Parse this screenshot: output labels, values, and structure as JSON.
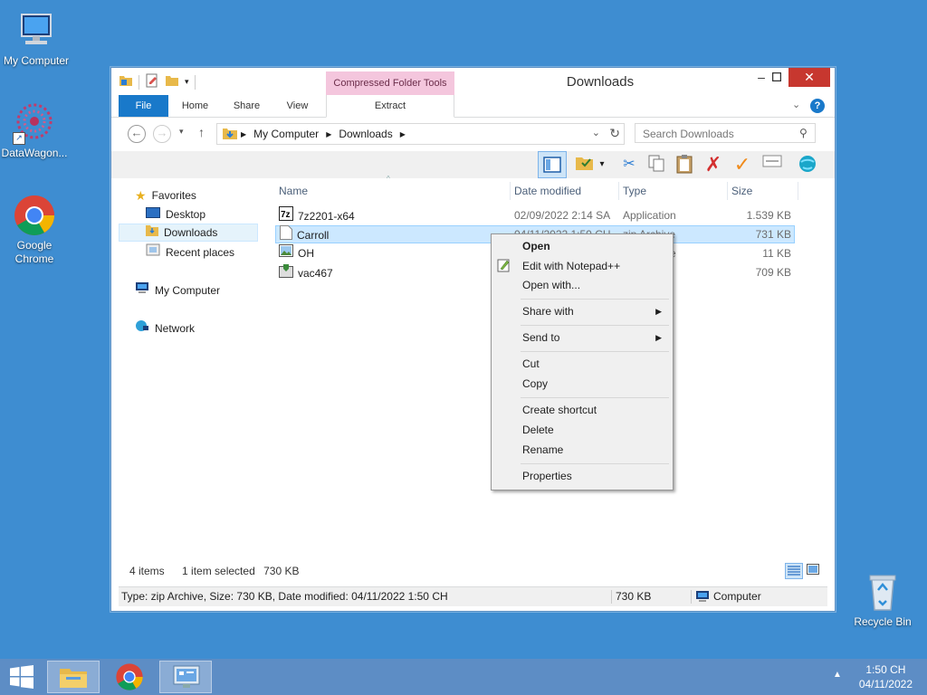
{
  "desktop": {
    "icons": [
      {
        "label": "My Computer"
      },
      {
        "label": "DataWagon..."
      },
      {
        "label": "Google Chrome"
      },
      {
        "label": "Recycle Bin"
      }
    ]
  },
  "window": {
    "title": "Downloads",
    "contextual_tab_group": "Compressed Folder Tools",
    "tabs": [
      {
        "label": "File"
      },
      {
        "label": "Home"
      },
      {
        "label": "Share"
      },
      {
        "label": "View"
      },
      {
        "label": "Extract"
      }
    ],
    "address": {
      "crumbs": [
        "My Computer",
        "Downloads"
      ]
    },
    "search": {
      "placeholder": "Search Downloads"
    },
    "nav": {
      "favorites": "Favorites",
      "desktop": "Desktop",
      "downloads": "Downloads",
      "recent": "Recent places",
      "computer": "My Computer",
      "network": "Network"
    },
    "columns": {
      "name": "Name",
      "date": "Date modified",
      "type": "Type",
      "size": "Size"
    },
    "files": [
      {
        "name": "7z2201-x64",
        "date": "02/09/2022 2:14 SA",
        "type": "Application",
        "size": "1.539 KB"
      },
      {
        "name": "Carroll",
        "date": "04/11/2022 1:50 CH",
        "type": "zip Archive",
        "size": "731 KB"
      },
      {
        "name": "OH",
        "date": "",
        "type": "e",
        "size": "11 KB"
      },
      {
        "name": "vac467",
        "date": "",
        "type": "n",
        "size": "709 KB"
      }
    ],
    "status": {
      "count": "4 items",
      "selected": "1 item selected",
      "selected_size": "730 KB"
    },
    "details_bar": {
      "info": "Type: zip Archive, Size: 730 KB, Date modified: 04/11/2022 1:50 CH",
      "size": "730 KB",
      "location": "Computer"
    }
  },
  "context_menu": {
    "open": "Open",
    "edit_notepad": "Edit with Notepad++",
    "open_with": "Open with...",
    "share_with": "Share with",
    "send_to": "Send to",
    "cut": "Cut",
    "copy": "Copy",
    "create_shortcut": "Create shortcut",
    "delete": "Delete",
    "rename": "Rename",
    "properties": "Properties"
  },
  "taskbar": {
    "time": "1:50 CH",
    "date": "04/11/2022"
  },
  "colors": {
    "desktop": "#3e8dd1",
    "file_tab": "#1979ca",
    "close": "#c7372f",
    "contextual": "#f4c6dd",
    "selection": "#cce8ff"
  }
}
